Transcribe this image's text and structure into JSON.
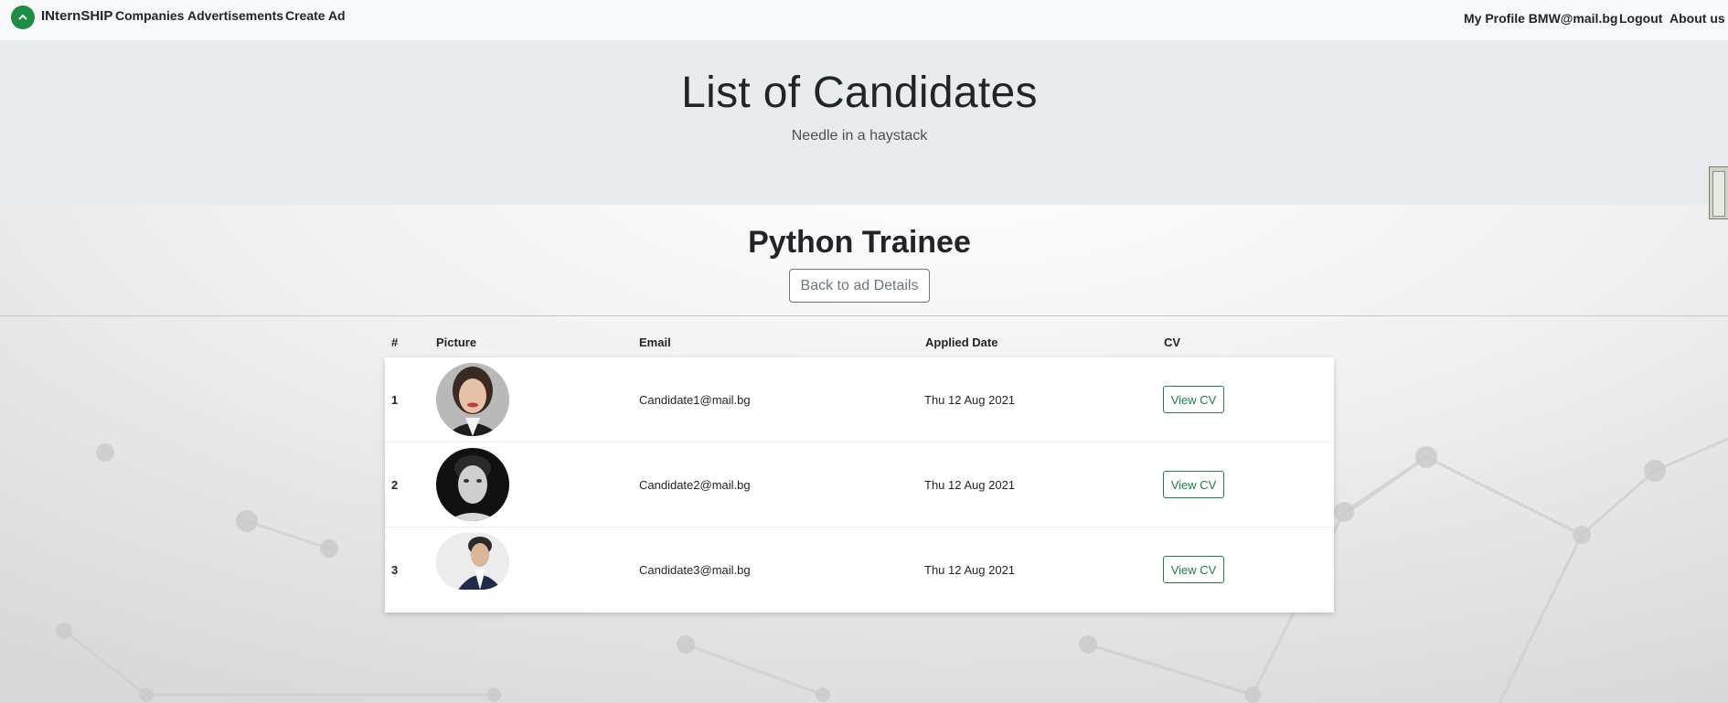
{
  "navbar": {
    "brand": "INternSHIP",
    "links": [
      "Companies",
      "Advertisements",
      "Create Ad"
    ],
    "right_links": [
      "My Profile BMW@mail.bg",
      "Logout",
      "About us"
    ]
  },
  "hero": {
    "title": "List of Candidates",
    "subtitle": "Needle in a haystack"
  },
  "advertisement": {
    "title": "Python Trainee",
    "back_button": "Back to ad Details"
  },
  "table": {
    "headers": [
      "#",
      "Picture",
      "Email",
      "Applied Date",
      "CV"
    ],
    "rows": [
      {
        "index": "1",
        "email": "Candidate1@mail.bg",
        "applied": "Thu 12 Aug 2021",
        "cv": "View CV"
      },
      {
        "index": "2",
        "email": "Candidate2@mail.bg",
        "applied": "Thu 12 Aug 2021",
        "cv": "View CV"
      },
      {
        "index": "3",
        "email": "Candidate3@mail.bg",
        "applied": "Thu 12 Aug 2021",
        "cv": "View CV"
      }
    ]
  },
  "colors": {
    "brand_green": "#1e8c45",
    "outline_green": "#1e7e44",
    "hero_bg": "#e9ecef",
    "navbar_bg": "#f8f9fa"
  }
}
